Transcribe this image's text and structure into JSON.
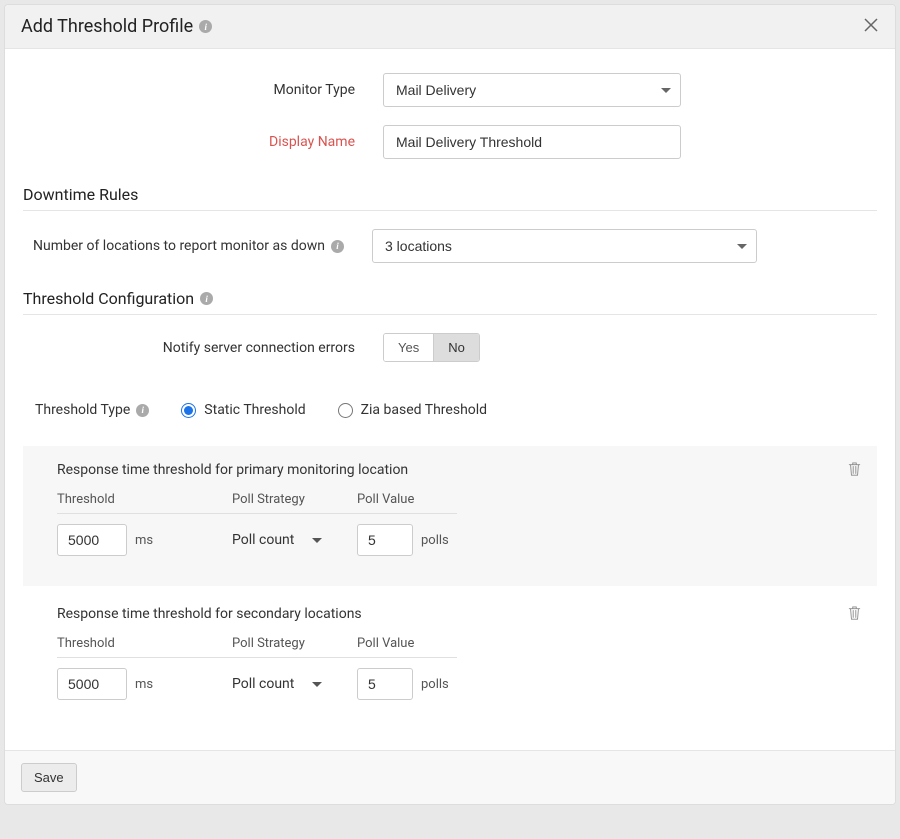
{
  "modal": {
    "title": "Add Threshold Profile"
  },
  "fields": {
    "monitorType": {
      "label": "Monitor Type",
      "value": "Mail Delivery"
    },
    "displayName": {
      "label": "Display Name",
      "value": "Mail Delivery Threshold"
    }
  },
  "downtime": {
    "sectionTitle": "Downtime Rules",
    "locationsLabel": "Number of locations to report monitor as down",
    "locationsValue": "3 locations"
  },
  "config": {
    "sectionTitle": "Threshold Configuration",
    "notifyLabel": "Notify server connection errors",
    "yes": "Yes",
    "no": "No"
  },
  "thresholdType": {
    "label": "Threshold Type",
    "static": "Static Threshold",
    "zia": "Zia based Threshold",
    "selected": "static"
  },
  "primary": {
    "title": "Response time threshold for primary monitoring location",
    "headers": {
      "threshold": "Threshold",
      "pollStrategy": "Poll Strategy",
      "pollValue": "Poll Value"
    },
    "thresholdValue": "5000",
    "thresholdUnit": "ms",
    "pollStrategy": "Poll count",
    "pollValue": "5",
    "pollUnit": "polls"
  },
  "secondary": {
    "title": "Response time threshold for secondary locations",
    "headers": {
      "threshold": "Threshold",
      "pollStrategy": "Poll Strategy",
      "pollValue": "Poll Value"
    },
    "thresholdValue": "5000",
    "thresholdUnit": "ms",
    "pollStrategy": "Poll count",
    "pollValue": "5",
    "pollUnit": "polls"
  },
  "footer": {
    "save": "Save"
  }
}
